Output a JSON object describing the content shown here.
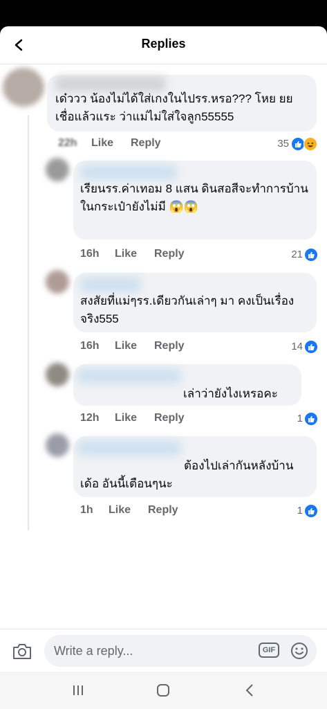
{
  "header": {
    "title": "Replies"
  },
  "comments": [
    {
      "text": "เด๋ววว น้องไม่ได้ใส่เกงในไปรร.หรอ???  โหย ยยเชื่อแล้วแระ  ว่าแม่ไม่ใส่ใจลูก55555",
      "time": "22h",
      "like": "Like",
      "reply": "Reply",
      "reactions": "35"
    },
    {
      "text": "เรียนรร.ค่าเทอม 8 แสน ดินสอสีจะทำการบ้านในกระเป๋ายังไม่มี 😱😱",
      "time": "16h",
      "like": "Like",
      "reply": "Reply",
      "reactions": "21"
    },
    {
      "text": "สงสัยที่แม่ๆรร.เดียวกันเล่าๆ มา คงเป็นเรื่องจริง555",
      "time": "16h",
      "like": "Like",
      "reply": "Reply",
      "reactions": "14"
    },
    {
      "text": "เล่าว่ายังไงเหรอคะ",
      "time": "12h",
      "like": "Like",
      "reply": "Reply",
      "reactions": "1"
    },
    {
      "text": "ต้องไปเล่ากันหลังบ้าน เด้อ อันนี้เตือนๆนะ",
      "time": "1h",
      "like": "Like",
      "reply": "Reply",
      "reactions": "1"
    }
  ],
  "composer": {
    "placeholder": "Write a reply...",
    "gif": "GIF"
  },
  "icons": {
    "back": "back-arrow-icon",
    "camera": "camera-icon",
    "emoji": "smiley-icon",
    "like": "like-reaction-icon",
    "haha": "haha-reaction-icon"
  },
  "colors": {
    "accent": "#1877f2",
    "bubble": "#f0f2f5",
    "meta": "#65676b"
  }
}
